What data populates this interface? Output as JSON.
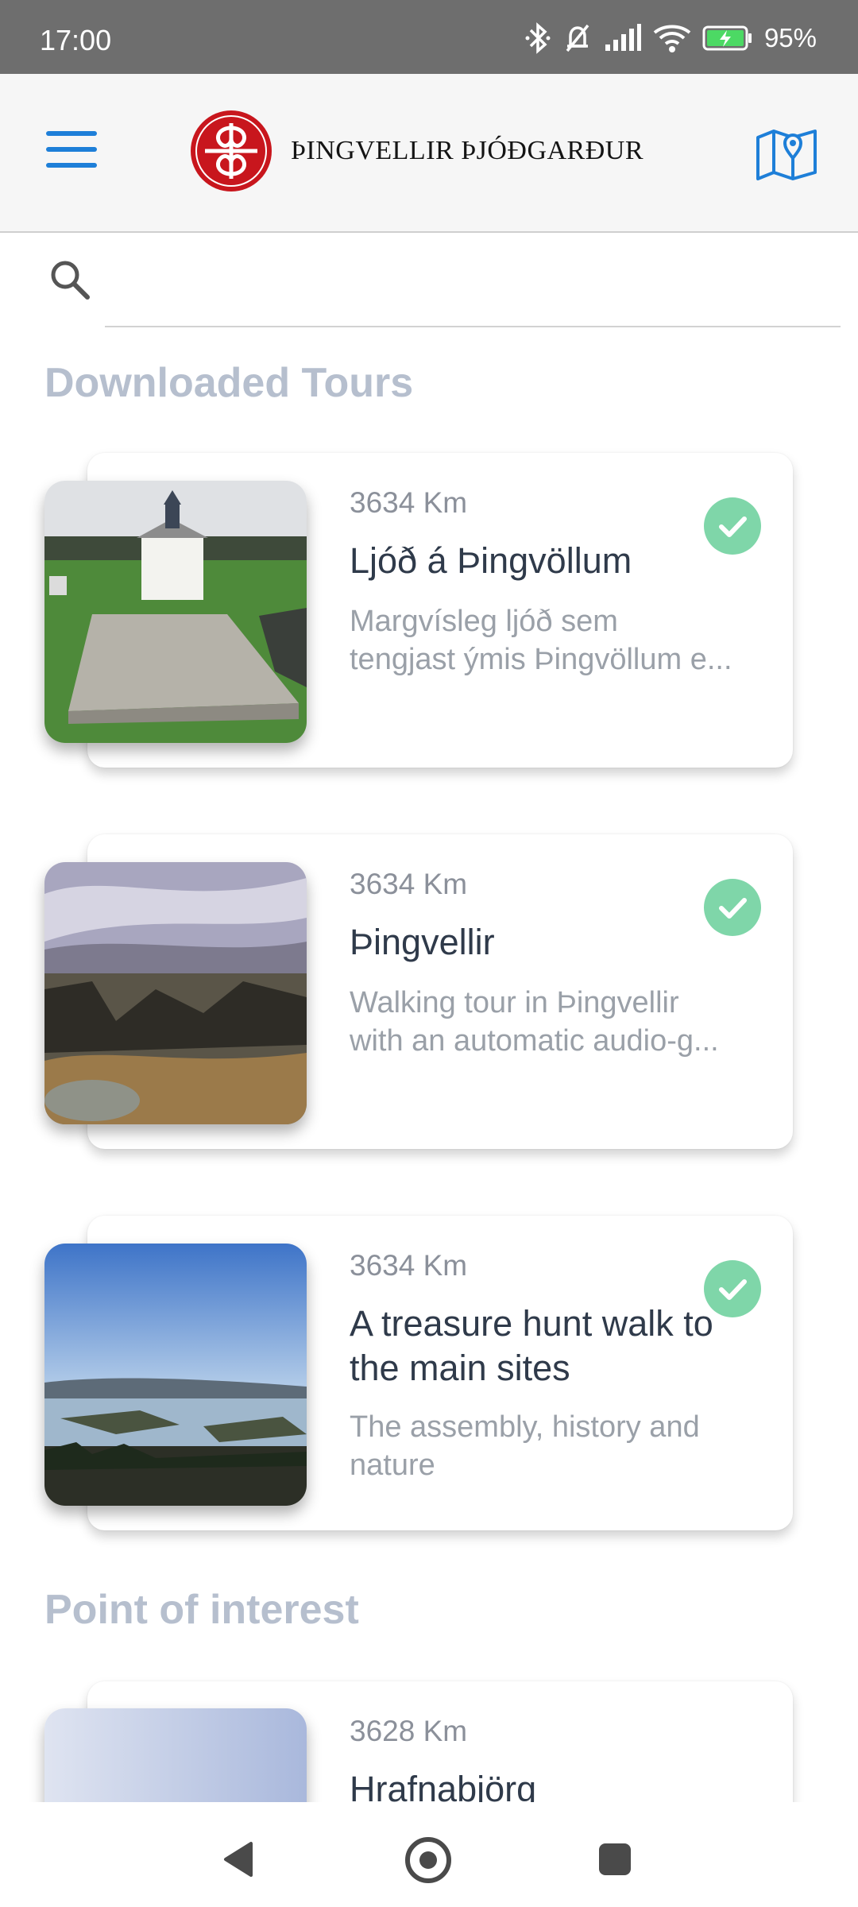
{
  "status_bar": {
    "time": "17:00",
    "battery": "95%",
    "icons": [
      "bluetooth-icon",
      "bell-off-icon",
      "signal-icon",
      "wifi-icon",
      "battery-charging-icon"
    ]
  },
  "app_bar": {
    "title": "ÞINGVELLIR ÞJÓÐGARÐUR",
    "menu_icon": "menu-icon",
    "map_icon": "map-pin-icon",
    "brand_color": "#c8161d",
    "accent_color": "#1e7fd8"
  },
  "search": {
    "placeholder": "",
    "value": ""
  },
  "sections": {
    "downloaded_title": "Downloaded Tours",
    "poi_title": "Point of interest"
  },
  "downloaded_tours": [
    {
      "distance": "3634 Km",
      "title": "Ljóð á Þingvöllum",
      "description_line1": "Margvísleg ljóð sem",
      "description_line2": "tengjast ýmis Þingvöllum e...",
      "downloaded": true
    },
    {
      "distance": "3634 Km",
      "title": "Þingvellir",
      "description_line1": "Walking tour in Þingvellir",
      "description_line2": "with an automatic audio-g...",
      "downloaded": true
    },
    {
      "distance": "3634 Km",
      "title_line1": "A treasure hunt walk to",
      "title_line2": "the main sites",
      "description_line1": "The assembly, history and",
      "description_line2": "nature",
      "downloaded": true
    }
  ],
  "points_of_interest": [
    {
      "distance": "3628 Km",
      "title": "Hrafnabjörg"
    }
  ],
  "colors": {
    "check_badge": "#7fd6a9",
    "section_title": "#b6bfce"
  }
}
